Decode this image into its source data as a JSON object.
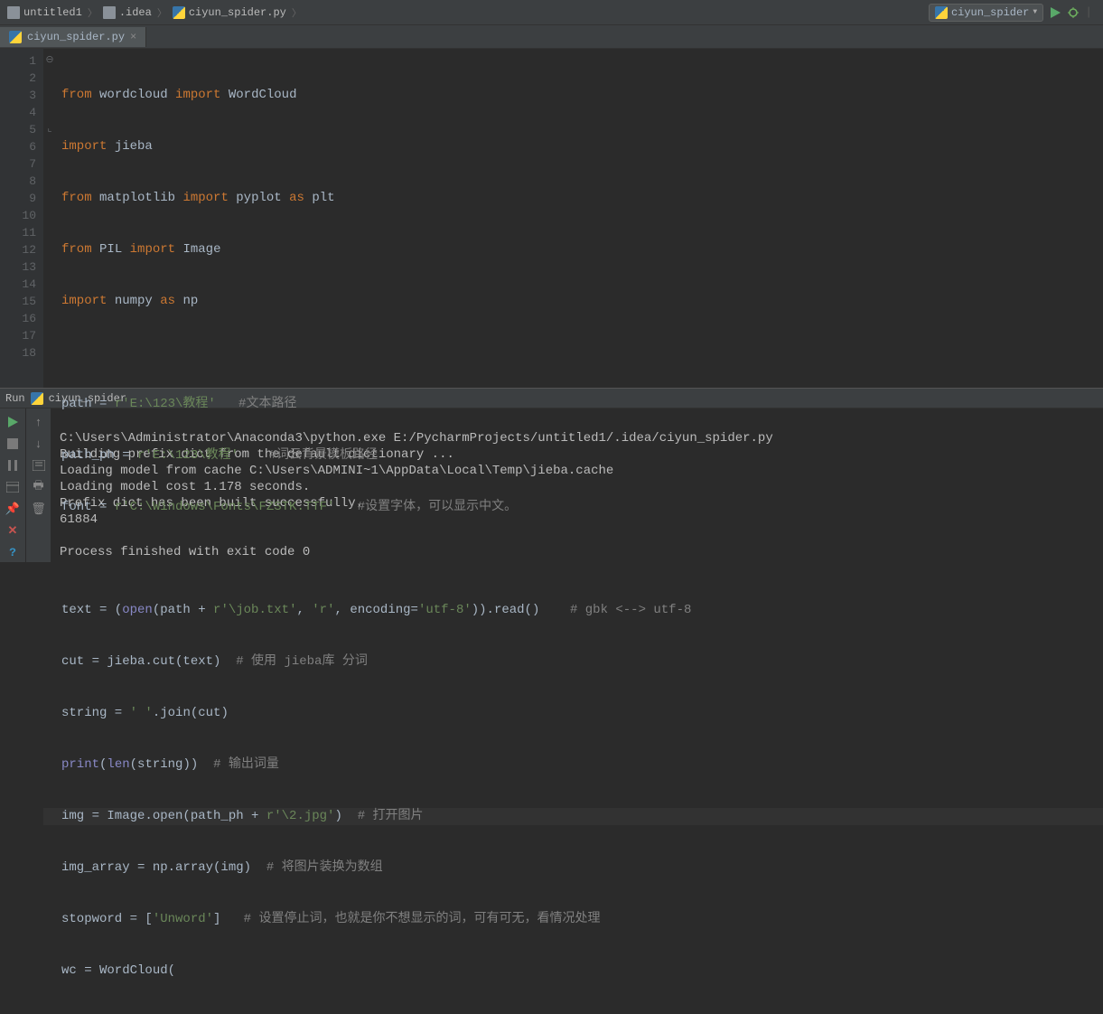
{
  "breadcrumbs": {
    "project": "untitled1",
    "folder": ".idea",
    "file": "ciyun_spider.py"
  },
  "run_config": {
    "name": "ciyun_spider"
  },
  "tab": {
    "name": "ciyun_spider.py"
  },
  "gutter": {
    "lines": [
      "1",
      "2",
      "3",
      "4",
      "5",
      "6",
      "7",
      "8",
      "9",
      "10",
      "11",
      "12",
      "13",
      "14",
      "15",
      "16",
      "17",
      "18"
    ]
  },
  "code": {
    "l1": {
      "from": "from",
      "mod": "wordcloud",
      "imp": "import",
      "name": "WordCloud"
    },
    "l2": {
      "imp": "import",
      "name": "jieba"
    },
    "l3": {
      "from": "from",
      "mod": "matplotlib",
      "imp": "import",
      "name": "pyplot",
      "as": "as",
      "alias": "plt"
    },
    "l4": {
      "from": "from",
      "mod": "PIL",
      "imp": "import",
      "name": "Image"
    },
    "l5": {
      "imp": "import",
      "name": "numpy",
      "as": "as",
      "alias": "np"
    },
    "l7": {
      "var": "path = ",
      "raw": "r",
      "str": "'E:\\123\\教程'",
      "comment": "   #文本路径"
    },
    "l8": {
      "var": "path_ph = ",
      "raw": "r",
      "str": "'E:\\123\\教程'",
      "comment": "    #词云背景模板路径"
    },
    "l9": {
      "var": "font = ",
      "raw": "r",
      "str": "'C:\\Windows\\Fonts\\FZSTK.TTF'",
      "comment": "   #设置字体，可以显示中文。"
    },
    "l11": {
      "pre": "text = (",
      "open": "open",
      "mid1": "(path + ",
      "raw1": "r",
      "str1": "'\\job.txt'",
      "c1": ", ",
      "str2": "'r'",
      "c2": ", ",
      "kw": "encoding",
      "eq": "=",
      "str3": "'utf-8'",
      "post": ")).read()    ",
      "comment": "# gbk <--> utf-8"
    },
    "l12": {
      "pre": "cut = jieba.cut(text)  ",
      "comment": "# 使用 jieba库 分词"
    },
    "l13": {
      "pre": "string = ",
      "str": "' '",
      "post": ".join(cut)"
    },
    "l14": {
      "fn": "print",
      "op": "(",
      "fn2": "len",
      "mid": "(string))  ",
      "comment": "# 输出词量"
    },
    "l15": {
      "pre": "img = Image.open(path_ph + ",
      "raw": "r",
      "str": "'\\2.jpg'",
      "post": ")  ",
      "comment": "# 打开图片"
    },
    "l16": {
      "pre": "img_array = np.array(img)  ",
      "comment": "# 将图片装换为数组"
    },
    "l17": {
      "pre": "stopword = [",
      "str": "'Unword'",
      "post": "]   ",
      "comment": "# 设置停止词，也就是你不想显示的词，可有可无，看情况处理"
    },
    "l18": {
      "pre": "wc = WordCloud("
    }
  },
  "run_panel": {
    "label": "Run",
    "name": "ciyun_spider"
  },
  "console": {
    "l1": "C:\\Users\\Administrator\\Anaconda3\\python.exe E:/PycharmProjects/untitled1/.idea/ciyun_spider.py",
    "l2": "Building prefix dict from the default dictionary ...",
    "l3": "Loading model from cache C:\\Users\\ADMINI~1\\AppData\\Local\\Temp\\jieba.cache",
    "l4": "Loading model cost 1.178 seconds.",
    "l5": "Prefix dict has been built successfully.",
    "l6": "61884",
    "l7": "",
    "l8": "Process finished with exit code 0"
  }
}
